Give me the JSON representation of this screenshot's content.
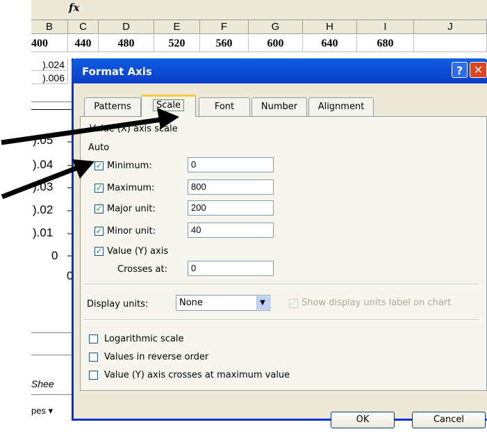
{
  "excel": {
    "formula_icon": "fx",
    "columns": [
      {
        "letter": "B",
        "value": "400"
      },
      {
        "letter": "C",
        "value": "440"
      },
      {
        "letter": "D",
        "value": "480"
      },
      {
        "letter": "E",
        "value": "520"
      },
      {
        "letter": "F",
        "value": "560"
      },
      {
        "letter": "G",
        "value": "600"
      },
      {
        "letter": "H",
        "value": "640"
      },
      {
        "letter": "I",
        "value": "680"
      },
      {
        "letter": "J",
        "value": ""
      }
    ],
    "row2_b": ").024",
    "row3_b": ").006",
    "y_ticks": [
      ").05",
      ").04",
      ").03",
      ").02",
      ").01",
      "0"
    ],
    "chart_x_zero": "0",
    "sheet_tab": "Shee",
    "toolbar_text": "pes ▾"
  },
  "dialog": {
    "title": "Format Axis",
    "help_label": "?",
    "close_label": "✕",
    "tabs": [
      "Patterns",
      "Scale",
      "Font",
      "Number",
      "Alignment"
    ],
    "active_tab": "Scale",
    "section_heading": "Value (X) axis scale",
    "auto_label": "Auto",
    "fields": [
      {
        "label": "Minimum:",
        "value": "0",
        "checked": true
      },
      {
        "label": "Maximum:",
        "value": "800",
        "checked": true
      },
      {
        "label": "Major unit:",
        "value": "200",
        "checked": true
      },
      {
        "label": "Minor unit:",
        "value": "40",
        "checked": true
      }
    ],
    "value_y_axis_label": "Value (Y) axis",
    "crosses_at_label": "Crosses at:",
    "crosses_at_value": "0",
    "display_units_label": "Display units:",
    "display_units_value": "None",
    "show_units_label": "Show display units label on chart",
    "options": [
      {
        "label": "Logarithmic scale",
        "checked": false
      },
      {
        "label": "Values in reverse order",
        "checked": false
      },
      {
        "label": "Value (Y) axis crosses at maximum value",
        "checked": false
      }
    ],
    "ok_label": "OK",
    "cancel_label": "Cancel"
  }
}
